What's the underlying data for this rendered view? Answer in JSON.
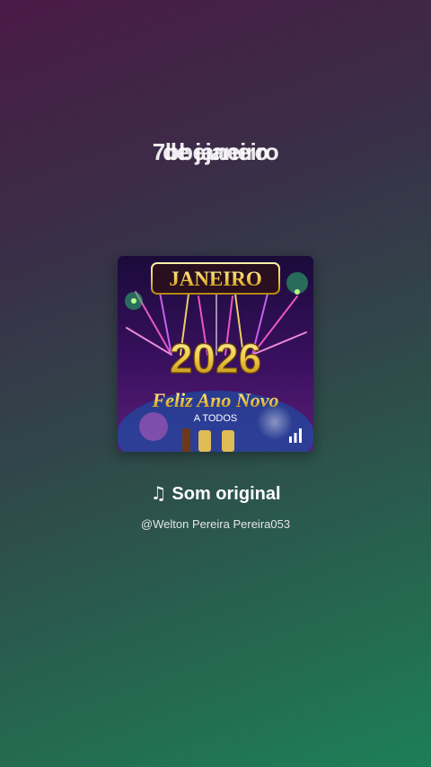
{
  "overlay": {
    "title_a": "7bbejaneiro",
    "title_b": "de janeiro"
  },
  "cover": {
    "month": "JANEIRO",
    "year": "2026",
    "greeting": "Feliz Ano Novo",
    "subgreeting": "A TODOS"
  },
  "sound": {
    "icon": "music-note-icon",
    "note_glyph": "♫",
    "title": "Som original",
    "author": "@Welton Pereira Pereira053"
  },
  "colors": {
    "bg_top": "#4a1a46",
    "bg_bottom": "#1d7f58",
    "gold": "#f2c94c"
  }
}
